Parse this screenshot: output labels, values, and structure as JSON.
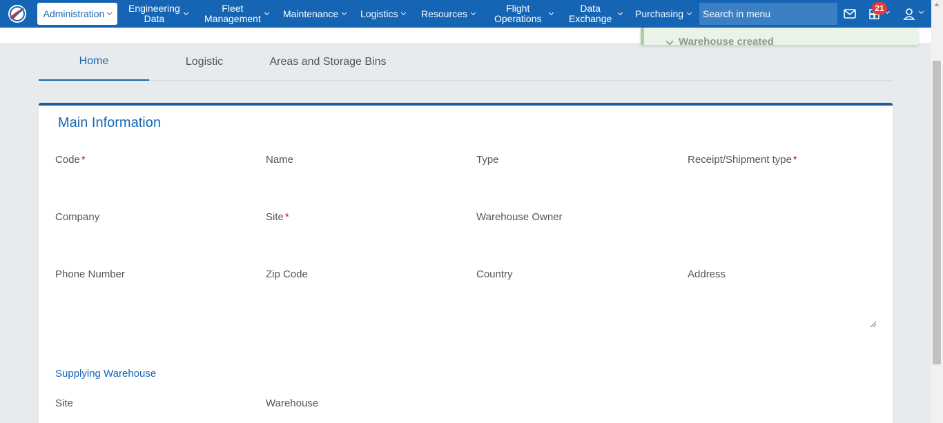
{
  "nav": {
    "admin_label": "Administration",
    "items": [
      {
        "line1": "Engineering",
        "line2": "Data"
      },
      {
        "line1": "Fleet",
        "line2": "Management"
      },
      {
        "line1": "Maintenance",
        "line2": ""
      },
      {
        "line1": "Logistics",
        "line2": ""
      },
      {
        "line1": "Resources",
        "line2": ""
      },
      {
        "line1": "Flight",
        "line2": "Operations"
      },
      {
        "line1": "Data",
        "line2": "Exchange"
      },
      {
        "line1": "Purchasing",
        "line2": ""
      }
    ],
    "search_placeholder": "Search in menu",
    "notification_count": "21",
    "icons": {
      "mail": "mail-icon",
      "tasks": "tasks-icon",
      "user": "user-icon"
    }
  },
  "toast": {
    "text": "Warehouse created"
  },
  "tabs": [
    {
      "label": "Home",
      "active": true
    },
    {
      "label": "Logistic",
      "active": false
    },
    {
      "label": "Areas and Storage Bins",
      "active": false
    }
  ],
  "main": {
    "title": "Main Information",
    "fields": {
      "code": "Code",
      "name": "Name",
      "type": "Type",
      "receipt_type": "Receipt/Shipment type",
      "company": "Company",
      "site": "Site",
      "warehouse_owner": "Warehouse Owner",
      "phone": "Phone Number",
      "zip": "Zip Code",
      "country": "Country",
      "address": "Address"
    },
    "required_mark": "*",
    "supplying": {
      "title": "Supplying Warehouse",
      "site": "Site",
      "warehouse": "Warehouse"
    }
  },
  "colors": {
    "primary": "#1565b4",
    "required": "#b71c1c",
    "badge": "#e53935"
  }
}
